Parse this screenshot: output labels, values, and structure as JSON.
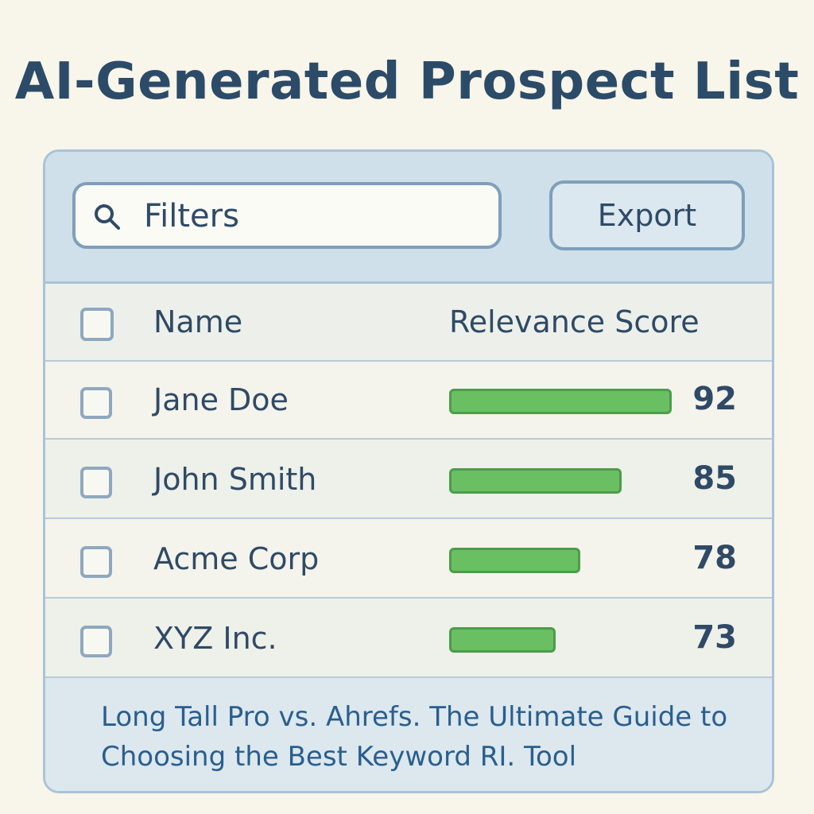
{
  "title": "AI-Generated Prospect List",
  "toolbar": {
    "search_icon": "search-icon",
    "filter_label": "Filters",
    "export_label": "Export"
  },
  "table": {
    "columns": [
      "Name",
      "Relevance Score"
    ],
    "rows": [
      {
        "name": "Jane Doe",
        "score": 92,
        "score_text": "92"
      },
      {
        "name": "John Smith",
        "score": 85,
        "score_text": "85"
      },
      {
        "name": "Acme Corp",
        "score": 78,
        "score_text": "78"
      },
      {
        "name": "XYZ Inc.",
        "score": 73,
        "score_text": "73"
      }
    ]
  },
  "footer": {
    "text": "Long Tall Pro vs. Ahrefs. The Ultimate Guide to Choosing the Best Keyword RI. Tool"
  },
  "colors": {
    "accent": "#2f4a66",
    "bar_fill": "#6abf63",
    "toolbar_bg": "#cfe0ea"
  }
}
